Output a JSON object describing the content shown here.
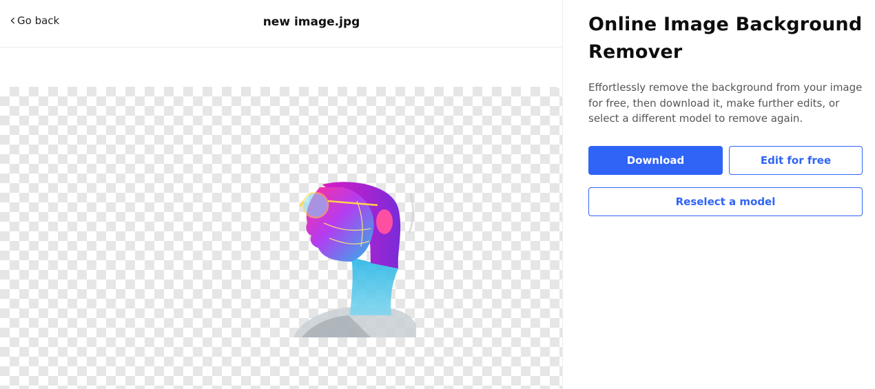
{
  "header": {
    "back_label": "Go back",
    "file_name": "new image.jpg"
  },
  "panel": {
    "title": "Online Image Background Remover",
    "description": "Effortlessly remove the background from your image for free, then download it, make further edits, or select a different model to remove again.",
    "download_label": "Download",
    "edit_label": "Edit for free",
    "reselect_label": "Reselect a model"
  },
  "colors": {
    "accent": "#2f64f6",
    "checker": "#e6e6e6"
  },
  "icons": {
    "back": "chevron-left-icon"
  }
}
